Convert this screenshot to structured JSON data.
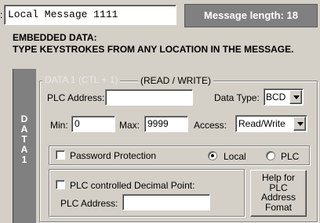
{
  "header": {
    "message_name": "Local Message 1111",
    "message_length": "Message length: 18",
    "edge_char": ":"
  },
  "notice": {
    "line1": "EMBEDDED DATA:",
    "line2": "TYPE KEYSTROKES FROM ANY LOCATION IN THE MESSAGE."
  },
  "side_label": [
    "D",
    "A",
    "T",
    "A",
    "1"
  ],
  "data1": {
    "group_title": "DATA 1 (CTL + 1)",
    "access_note": "(READ / WRITE)",
    "plc_address_label": "PLC Address:",
    "plc_address_value": "",
    "data_type_label": "Data Type:",
    "data_type_value": "BCD",
    "min_label": "Min:",
    "min_value": "0",
    "max_label": "Max:",
    "max_value": "9999",
    "access_label": "Access:",
    "access_value": "Read/Write",
    "password_label": "Password Protection",
    "password_checked": false,
    "radio_local": "Local",
    "radio_plc": "PLC",
    "selected_radio": "Local",
    "decimal_label": "PLC controlled Decimal Point:",
    "decimal_checked": false,
    "decimal_address_label": "PLC Address:",
    "decimal_address_value": "",
    "help_button": [
      "Help for",
      "PLC",
      "Address",
      "Fomat"
    ]
  },
  "colors": {
    "window_bg": "#d4d0c8",
    "length_panel_bg": "#808080",
    "length_text": "#ffffff",
    "label_gray": "#e8e8e8"
  }
}
